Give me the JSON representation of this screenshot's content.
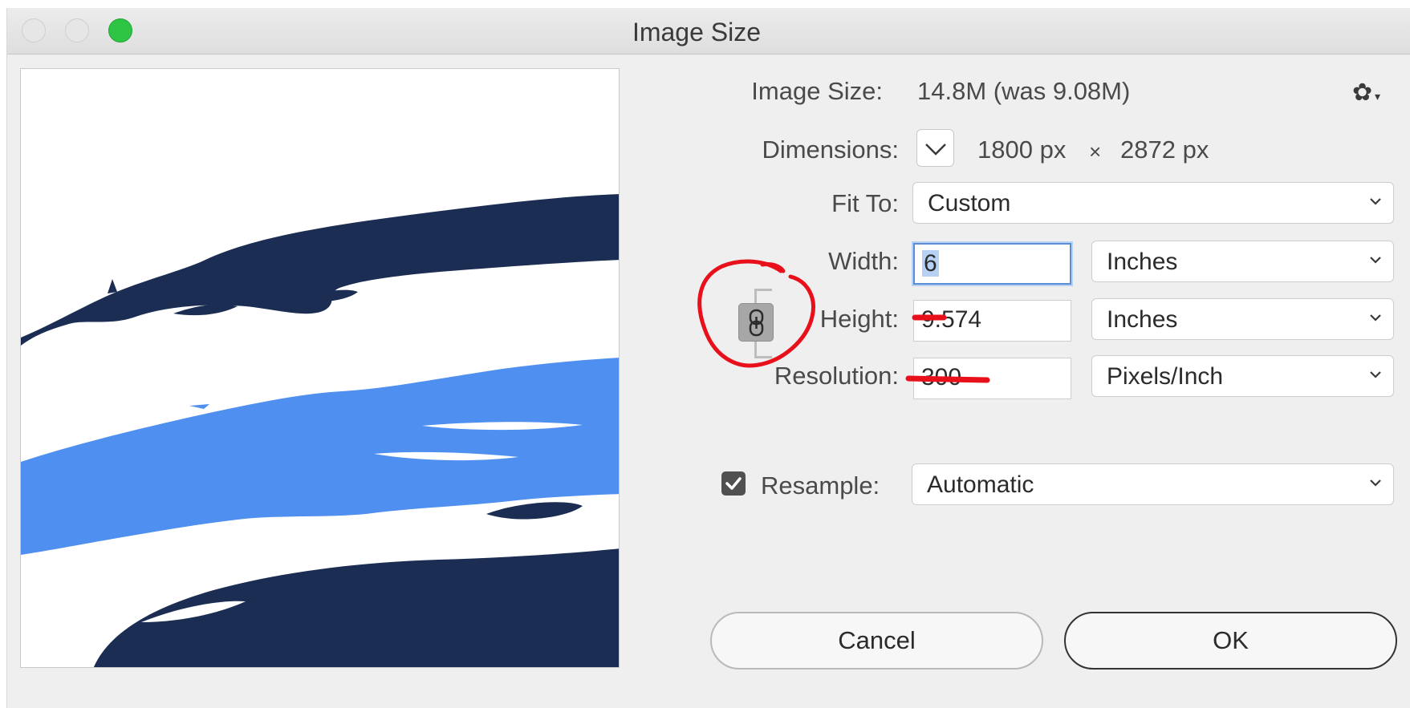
{
  "window": {
    "title": "Image Size",
    "traffic_lights": [
      "close",
      "minimize",
      "zoom"
    ]
  },
  "image_size": {
    "label": "Image Size:",
    "value": "14.8M (was 9.08M)"
  },
  "dimensions": {
    "label": "Dimensions:",
    "width_value": "1800 px",
    "separator": "×",
    "height_value": "2872 px"
  },
  "fit_to": {
    "label": "Fit To:",
    "selected": "Custom"
  },
  "width": {
    "label": "Width:",
    "value": "6",
    "unit": "Inches"
  },
  "height": {
    "label": "Height:",
    "value": "9.574",
    "unit": "Inches"
  },
  "resolution": {
    "label": "Resolution:",
    "value": "300",
    "unit": "Pixels/Inch"
  },
  "resample": {
    "label": "Resample:",
    "checked": true,
    "selected": "Automatic"
  },
  "buttons": {
    "cancel": "Cancel",
    "ok": "OK"
  },
  "icons": {
    "settings": "gear-icon",
    "constrain": "link-chain-icon",
    "dropdown": "chevron-down-icon",
    "checkbox": "checkmark-icon"
  },
  "colors": {
    "preview_dark_navy": "#1b2d52",
    "preview_light_blue": "#4f8ff0",
    "annotation_red": "#e8101a",
    "focus_blue": "#5a8fd8",
    "traffic_green": "#2ec544"
  }
}
